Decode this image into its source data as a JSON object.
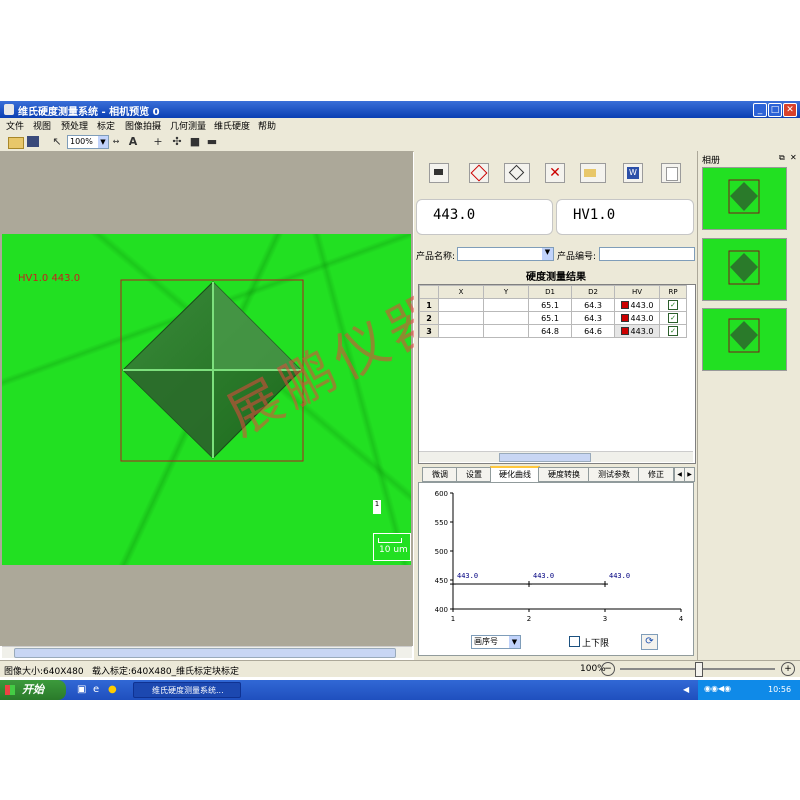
{
  "window": {
    "title": "维氏硬度测量系统 - 相机预览 0",
    "min": "_",
    "max": "□",
    "close": "✕"
  },
  "menu": [
    "文件",
    "视图",
    "预处理",
    "标定",
    "图像拍摄",
    "几何测量",
    "维氏硬度",
    "帮助"
  ],
  "toolbar": {
    "zoom": "100%",
    "text_tool": "A"
  },
  "camera": {
    "overlay_label": "HV1.0  443.0",
    "scale_bar": "10 um",
    "vertical_scale": "1"
  },
  "readouts": {
    "hardness": "443.0",
    "scale": "HV1.0"
  },
  "form": {
    "product_name_label": "产品名称:",
    "product_id_label": "产品编号:",
    "product_name": "",
    "product_id": ""
  },
  "results": {
    "title": "硬度测量结果",
    "columns": [
      "",
      "X",
      "Y",
      "D1",
      "D2",
      "HV",
      "RP"
    ],
    "rows": [
      {
        "n": "1",
        "x": "",
        "y": "",
        "d1": "65.1",
        "d2": "64.3",
        "hv": "443.0"
      },
      {
        "n": "2",
        "x": "",
        "y": "",
        "d1": "65.1",
        "d2": "64.3",
        "hv": "443.0"
      },
      {
        "n": "3",
        "x": "",
        "y": "",
        "d1": "64.8",
        "d2": "64.6",
        "hv": "443.0"
      }
    ]
  },
  "tabs": [
    "微调",
    "设置",
    "硬化曲线",
    "硬度转换",
    "测试参数",
    "修正"
  ],
  "active_tab": "硬化曲线",
  "chart_data": {
    "type": "line",
    "x": [
      1,
      2,
      3
    ],
    "series": [
      {
        "values": [
          443.0,
          443.0,
          443.0
        ]
      }
    ],
    "point_labels": [
      "443.0",
      "443.0",
      "443.0"
    ],
    "ylim": [
      400,
      600
    ],
    "yticks": [
      400,
      450,
      500,
      550,
      600
    ],
    "xlim": [
      1,
      4
    ],
    "xticks": [
      1,
      2,
      3,
      4
    ],
    "color": "#000080"
  },
  "chart_controls": {
    "x_select": "画序号",
    "checkbox_label": "上下限"
  },
  "status": {
    "image_size": "图像大小:640X480",
    "calib": "载入标定:640X480_维氏标定块标定",
    "zoom": "100%"
  },
  "album": {
    "title": "相册"
  },
  "taskbar": {
    "start": "开始",
    "task": "维氏硬度测量系统...",
    "clock": "10:56"
  },
  "watermark": "展鹏仪器",
  "colors": {
    "camera_green": "#22e022",
    "title_blue": "#0a3fb3"
  }
}
